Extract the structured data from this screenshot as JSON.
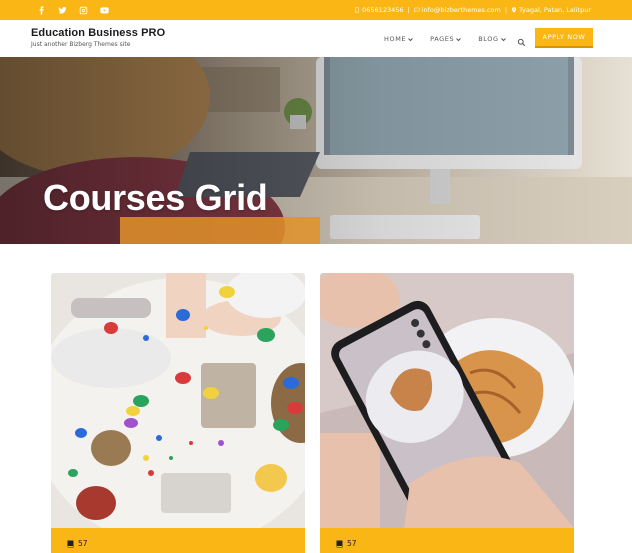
{
  "topbar": {
    "social_icons": [
      "facebook-icon",
      "twitter-icon",
      "instagram-icon",
      "youtube-icon"
    ],
    "phone": "0656123456",
    "email": "info@bizberthemes.com",
    "address": "Tyagal, Patan, Lalitpur",
    "separator": "|"
  },
  "header": {
    "site_title": "Education Business PRO",
    "tagline": "Just another Bizberg Themes site",
    "nav": [
      {
        "label": "HOME",
        "icon": "chevron-down-icon"
      },
      {
        "label": "PAGES",
        "icon": "chevron-down-icon"
      },
      {
        "label": "BLOG",
        "icon": "chevron-down-icon"
      }
    ],
    "search_icon": "search-icon",
    "apply_label": "APPLY NOW"
  },
  "hero": {
    "heading": "Courses Grid"
  },
  "courses": [
    {
      "lessons": "57",
      "icon": "book-icon"
    },
    {
      "lessons": "57",
      "icon": "book-icon"
    }
  ],
  "colors": {
    "accent": "#f9b615",
    "white": "#ffffff",
    "text_dark": "#1b1b1b"
  }
}
